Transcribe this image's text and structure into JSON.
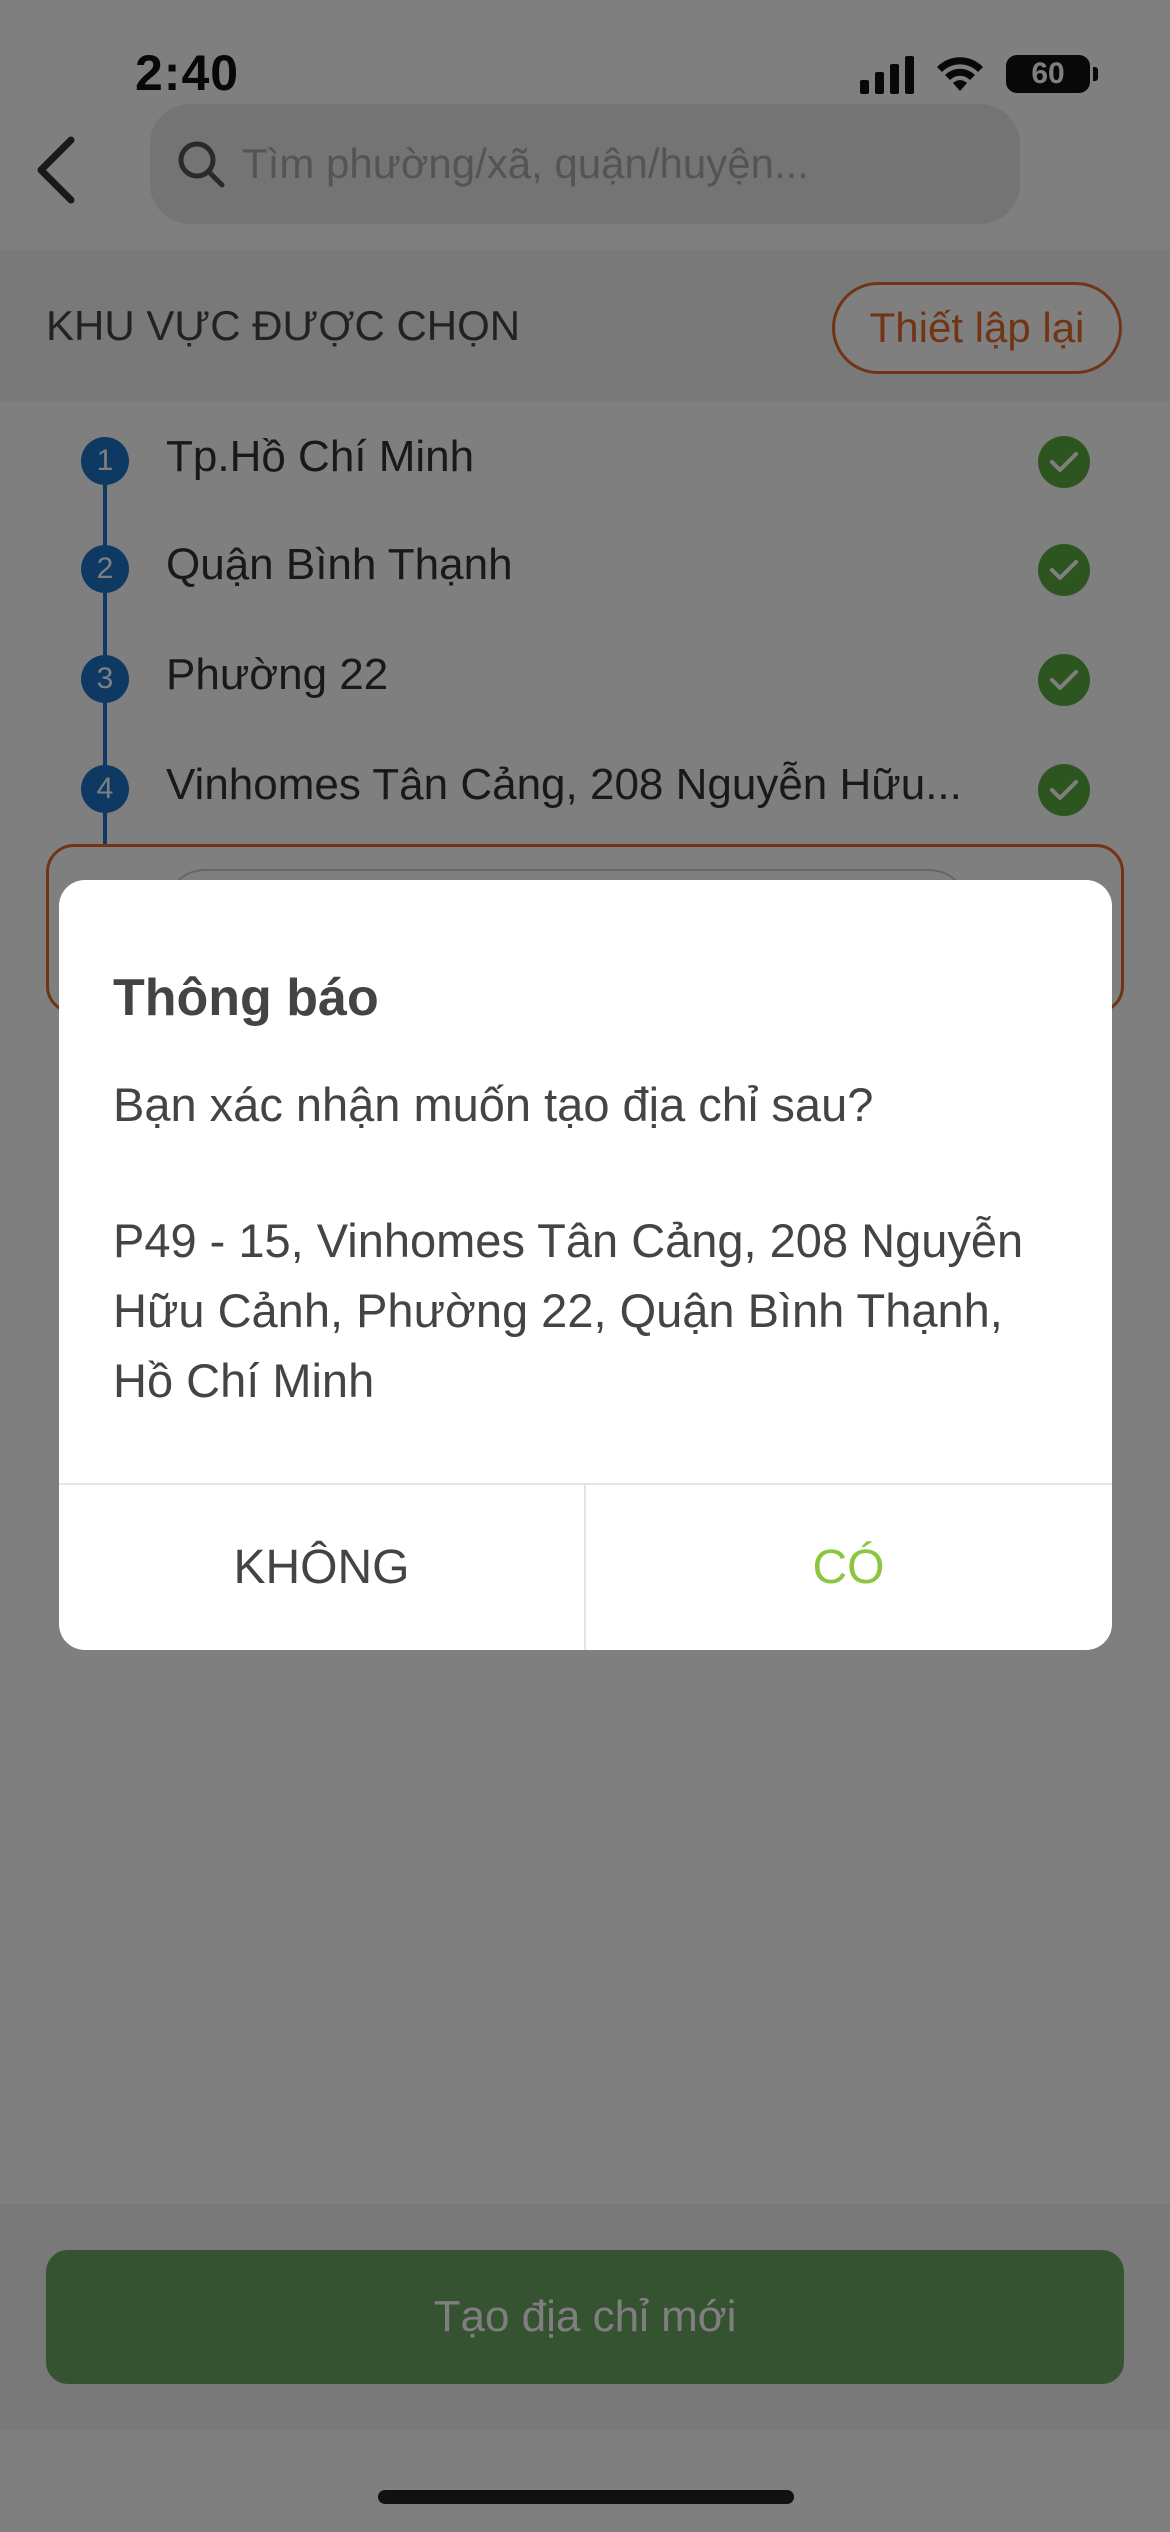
{
  "status_bar": {
    "time": "2:40",
    "battery": "60"
  },
  "header": {
    "search_placeholder": "Tìm phường/xã, quận/huyện..."
  },
  "selection": {
    "title": "KHU VỰC ĐƯỢC CHỌN",
    "reset_label": "Thiết lập lại",
    "steps": [
      {
        "num": "1",
        "label": "Tp.Hồ Chí Minh"
      },
      {
        "num": "2",
        "label": "Quận Bình Thạnh"
      },
      {
        "num": "3",
        "label": "Phường 22"
      },
      {
        "num": "4",
        "label": "Vinhomes Tân Cảng,  208 Nguyễn Hữu..."
      }
    ]
  },
  "bottom": {
    "create_label": "Tạo địa chỉ mới"
  },
  "dialog": {
    "title": "Thông báo",
    "message": "Bạn xác nhận muốn tạo địa chỉ sau?",
    "address": "P49 - 15, Vinhomes Tân Cảng,  208 Nguyễn Hữu Cảnh, Phường 22, Quận Bình Thạnh, Hồ Chí Minh",
    "no_label": "KHÔNG",
    "yes_label": "CÓ"
  },
  "colors": {
    "accent_orange": "#e2692b",
    "step_blue": "#1a73c7",
    "check_green": "#5aaa3f",
    "yes_green": "#8cc540",
    "button_green": "#6ba661"
  }
}
